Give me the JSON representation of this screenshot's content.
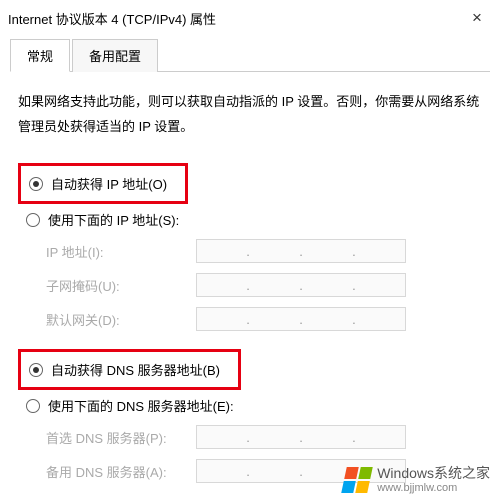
{
  "window": {
    "title": "Internet 协议版本 4 (TCP/IPv4) 属性",
    "close": "×"
  },
  "tabs": {
    "general": "常规",
    "alternate": "备用配置"
  },
  "description": "如果网络支持此功能，则可以获取自动指派的 IP 设置。否则，你需要从网络系统管理员处获得适当的 IP 设置。",
  "ip": {
    "auto": "自动获得 IP 地址(O)",
    "manual": "使用下面的 IP 地址(S):",
    "fields": {
      "address": "IP 地址(I):",
      "subnet": "子网掩码(U):",
      "gateway": "默认网关(D):"
    }
  },
  "dns": {
    "auto": "自动获得 DNS 服务器地址(B)",
    "manual": "使用下面的 DNS 服务器地址(E):",
    "fields": {
      "preferred": "首选 DNS 服务器(P):",
      "alternate": "备用 DNS 服务器(A):"
    }
  },
  "watermark": {
    "title": "Windows系统之家",
    "url": "www.bjjmlw.com",
    "colors": [
      "#f25022",
      "#7fba00",
      "#00a4ef",
      "#ffb900"
    ]
  }
}
